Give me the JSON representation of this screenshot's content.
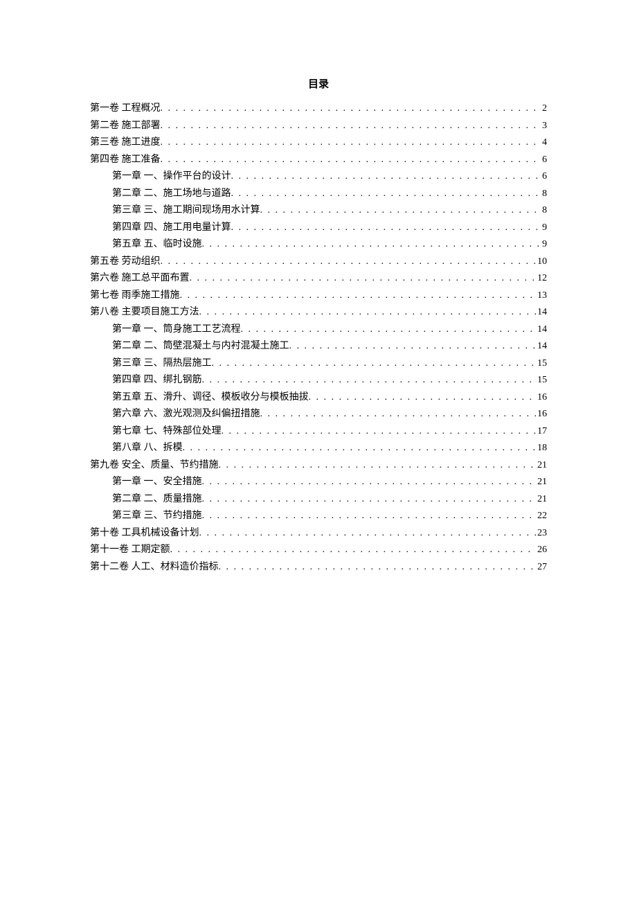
{
  "title": "目录",
  "entries": [
    {
      "label": "第一卷 工程概况",
      "page": "2",
      "indent": false
    },
    {
      "label": "第二卷 施工部署",
      "page": "3",
      "indent": false
    },
    {
      "label": "第三卷 施工进度",
      "page": "4",
      "indent": false
    },
    {
      "label": "第四卷 施工准备",
      "page": "6",
      "indent": false
    },
    {
      "label": "第一章 一、操作平台的设计",
      "page": "6",
      "indent": true
    },
    {
      "label": "第二章 二、施工场地与道路",
      "page": "8",
      "indent": true
    },
    {
      "label": "第三章 三、施工期间现场用水计算",
      "page": "8",
      "indent": true
    },
    {
      "label": "第四章 四、施工用电量计算",
      "page": "9",
      "indent": true
    },
    {
      "label": "第五章 五、临时设施",
      "page": "9",
      "indent": true
    },
    {
      "label": "第五卷 劳动组织",
      "page": "10",
      "indent": false
    },
    {
      "label": "第六卷 施工总平面布置",
      "page": "12",
      "indent": false
    },
    {
      "label": "第七卷 雨季施工措施",
      "page": "13",
      "indent": false
    },
    {
      "label": "第八卷 主要项目施工方法",
      "page": "14",
      "indent": false
    },
    {
      "label": "第一章 一、筒身施工工艺流程",
      "page": "14",
      "indent": true
    },
    {
      "label": "第二章 二、筒壁混凝土与内衬混凝土施工",
      "page": "14",
      "indent": true
    },
    {
      "label": "第三章 三、隔热层施工",
      "page": "15",
      "indent": true
    },
    {
      "label": "第四章 四、绑扎钢筋",
      "page": "15",
      "indent": true
    },
    {
      "label": "第五章 五、滑升、调径、模板收分与模板抽拔",
      "page": "16",
      "indent": true
    },
    {
      "label": "第六章 六、激光观测及纠偏扭措施",
      "page": "16",
      "indent": true
    },
    {
      "label": "第七章 七、特殊部位处理",
      "page": "17",
      "indent": true
    },
    {
      "label": "第八章 八、拆模",
      "page": "18",
      "indent": true
    },
    {
      "label": "第九卷 安全、质量、节约措施",
      "page": "21",
      "indent": false
    },
    {
      "label": "第一章 一、安全措施",
      "page": "21",
      "indent": true
    },
    {
      "label": "第二章 二、质量措施",
      "page": "21",
      "indent": true
    },
    {
      "label": "第三章 三、节约措施",
      "page": "22",
      "indent": true
    },
    {
      "label": "第十卷 工具机械设备计划",
      "page": "23",
      "indent": false
    },
    {
      "label": "第十一卷 工期定额",
      "page": "26",
      "indent": false
    },
    {
      "label": "第十二卷 人工、材料造价指标",
      "page": "27",
      "indent": false
    }
  ]
}
